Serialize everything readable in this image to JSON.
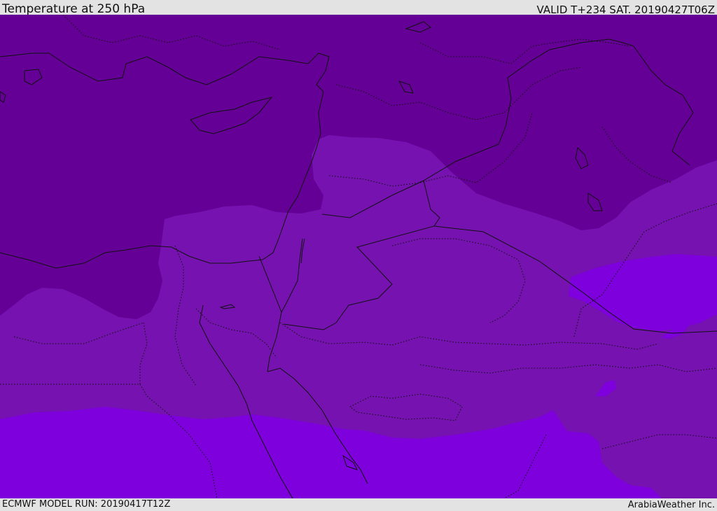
{
  "header": {
    "title": "Temperature at 250 hPa",
    "valid_time": "VALID T+234 SAT. 20190427T06Z"
  },
  "footer": {
    "model_run": "ECMWF MODEL RUN: 20190417T12Z",
    "credit": "ArabiaWeather Inc."
  },
  "colors": {
    "dark_band": "#650096",
    "mid_band": "#7512b0",
    "light_band": "#7d00dd",
    "border": "#111111"
  }
}
